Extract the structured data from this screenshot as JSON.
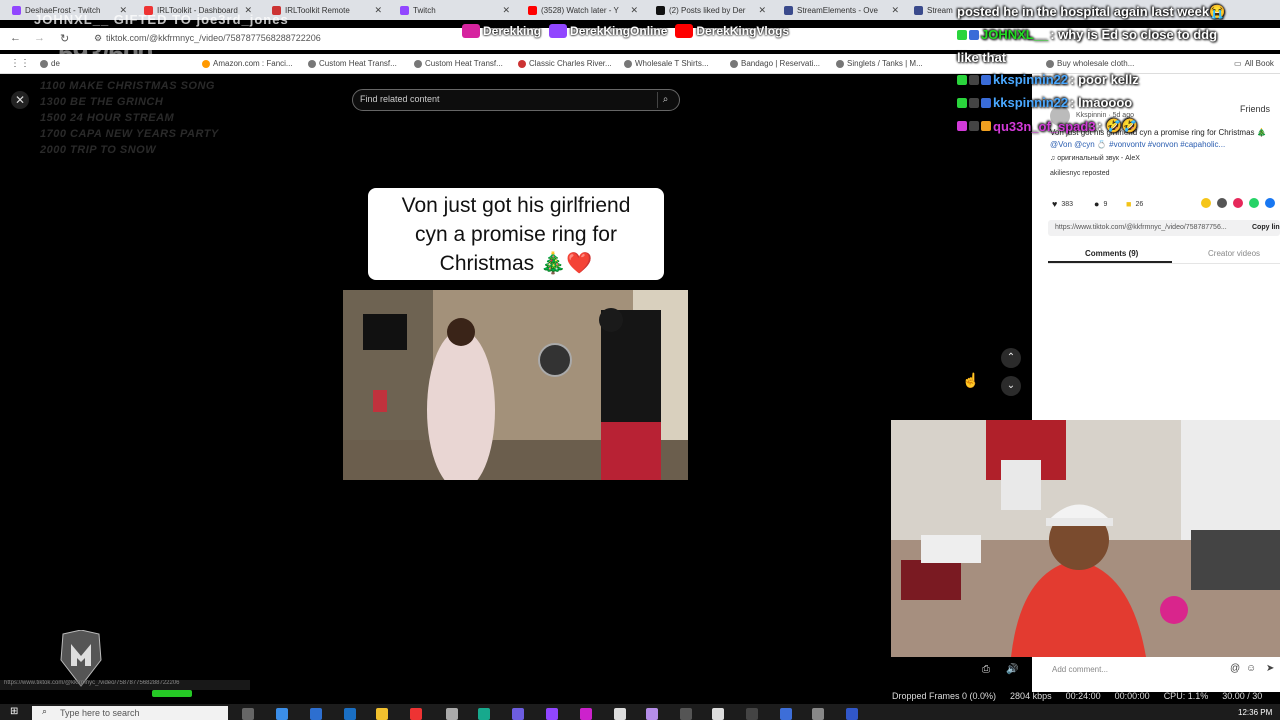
{
  "browser": {
    "tabs": [
      {
        "label": "DeshaeFrost - Twitch",
        "color": "#9146ff"
      },
      {
        "label": "IRLToolkit - Dashboard",
        "color": "#e33"
      },
      {
        "label": "IRLToolkit Remote",
        "color": "#c33"
      },
      {
        "label": "Twitch",
        "color": "#9146ff"
      },
      {
        "label": "(3528) Watch later - Y",
        "color": "#f00"
      },
      {
        "label": "(2) Posts liked by Der",
        "color": "#111"
      },
      {
        "label": "StreamElements - Ove",
        "color": "#3a4a8c"
      },
      {
        "label": "Stream",
        "color": "#3a4a8c"
      }
    ],
    "url": "tiktok.com/@kkfrmnyc_/video/7587877568288722206",
    "bookmarks": [
      "de",
      "Amazon.com : Fanci...",
      "Custom Heat Transf...",
      "Custom Heat Transf...",
      "Classic Charles River...",
      "Wholesale T Shirts...",
      "Bandago | Reservati...",
      "Singlets / Tanks | M...",
      "Buy wholesale cloth...",
      "All Book"
    ]
  },
  "overlay": {
    "counter": "593/600",
    "gifted": "JOHNXL__ GIFTED TO joe3rd_jones",
    "schedule": [
      "1100 MAKE CHRISTMAS SONG",
      "1300 BE THE GRINCH",
      "1500 24 HOUR STREAM",
      "1700 CAPA NEW YEARS PARTY",
      "2000 TRIP TO SNOW"
    ],
    "socials": [
      {
        "name": "Derekking",
        "icon": "instagram-icon",
        "color": "#d6249f"
      },
      {
        "name": "DerekKingOnline",
        "icon": "twitch-icon",
        "color": "#9146ff"
      },
      {
        "name": "DerekKingVlogs",
        "icon": "youtube-icon",
        "color": "#f00"
      }
    ]
  },
  "tiktok": {
    "search_placeholder": "Find related content",
    "caption_line1": "Von just got his girlfriend",
    "caption_line2": "cyn a promise ring for",
    "caption_line3": "Christmas 🎄❤️",
    "friends": "Friends",
    "author": "Kkspinnin · 5d ago",
    "description": "Von just got his girlfriend cyn a promise ring for Christmas 🎄",
    "tags": "@Von @cyn 💍 #vonvontv #vonvon #capaholic...",
    "sound": "♫ оригинальный звук - AleX",
    "reposted": "akiliesnyc reposted",
    "likes": "383",
    "comments_count": "9",
    "saves": "26",
    "link": "https://www.tiktok.com/@kkfrmnyc_/video/758787756...",
    "copy_link": "Copy lin",
    "tab_comments": "Comments (9)",
    "tab_creator": "Creator videos",
    "add_comment": "Add comment...",
    "status_url": "https://www.tiktok.com/@kkfrmnyc_/video/7587877568288722206"
  },
  "chat": [
    {
      "user": "",
      "text": "posted he in the hospital again last week😭",
      "color": "#ffffff"
    },
    {
      "user": "JOHNXL__",
      "text": ": why is Ed so close to ddg",
      "color": "#22dd22"
    },
    {
      "user": "",
      "text": "like that",
      "color": "#ffffff"
    },
    {
      "user": "kkspinnin22",
      "text": ": poor kellz",
      "color": "#4aa8ff"
    },
    {
      "user": "kkspinnin22",
      "text": ": lmaoooo",
      "color": "#4aa8ff"
    },
    {
      "user": "qu33n_of_spad3",
      "text": ": 🤣🤣",
      "color": "#d23ad8"
    }
  ],
  "obs": {
    "dropped": "Dropped Frames 0 (0.0%)",
    "bitrate": "2804 kbps",
    "time": "00:24:00",
    "time2": "00:00:00",
    "cpu": "CPU: 1.1%",
    "fps": "30.00 / 30"
  },
  "taskbar": {
    "search": "Type here to search",
    "clock": "12:36 PM"
  }
}
